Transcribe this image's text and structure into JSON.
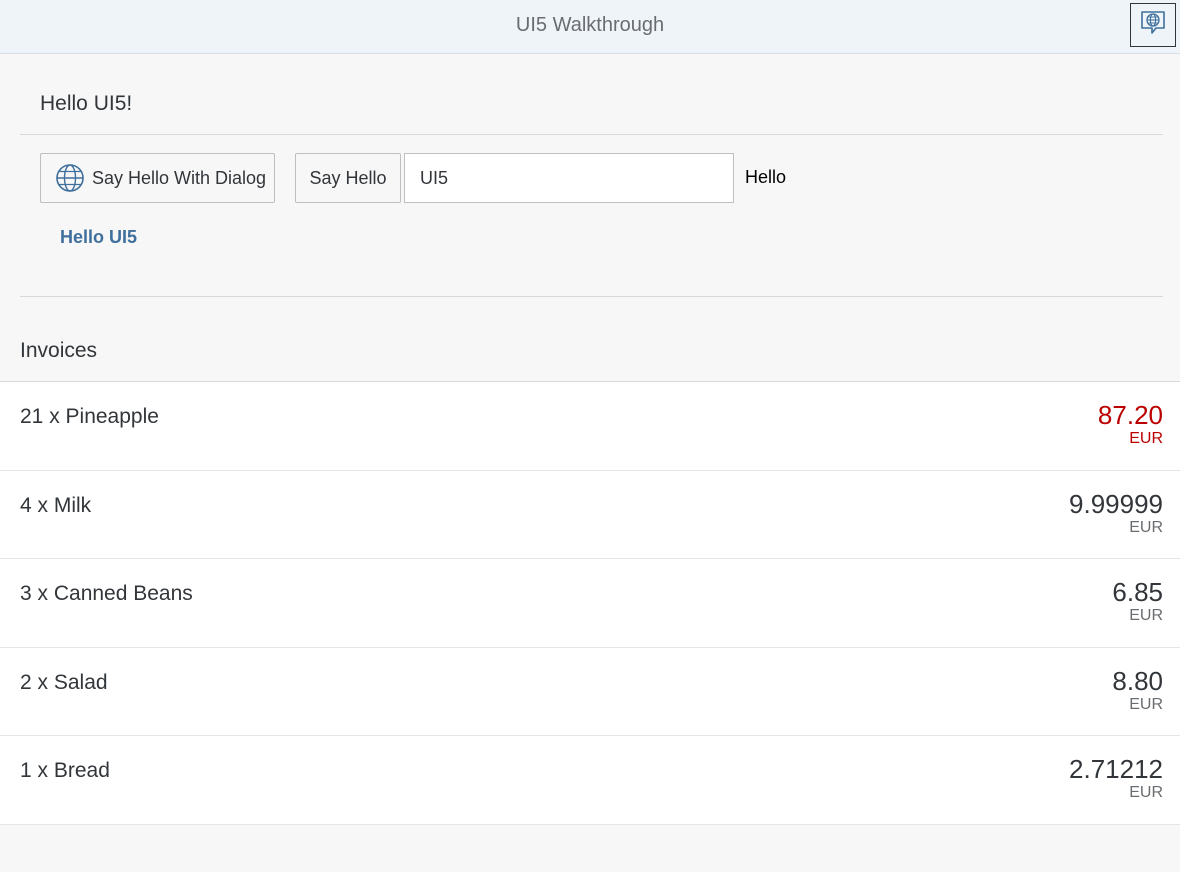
{
  "shell": {
    "title": "UI5 Walkthrough",
    "feedback_icon": "feedback-globe-icon"
  },
  "panel": {
    "title": "Hello UI5!",
    "dialog_button_label": "Say Hello With Dialog",
    "dialog_button_icon": "world-icon",
    "hello_button_label": "Say Hello",
    "name_input_value": "UI5",
    "greeting_text": "Hello",
    "link_text": "Hello UI5"
  },
  "invoices": {
    "title": "Invoices",
    "items": [
      {
        "title": "21 x Pineapple",
        "amount": "87.20",
        "currency": "EUR",
        "state": "error"
      },
      {
        "title": "4 x Milk",
        "amount": "9.99999",
        "currency": "EUR",
        "state": "none"
      },
      {
        "title": "3 x Canned Beans",
        "amount": "6.85",
        "currency": "EUR",
        "state": "none"
      },
      {
        "title": "2 x Salad",
        "amount": "8.80",
        "currency": "EUR",
        "state": "none"
      },
      {
        "title": "1 x Bread",
        "amount": "2.71212",
        "currency": "EUR",
        "state": "none"
      }
    ]
  },
  "colors": {
    "shell_background": "#eff4f9",
    "page_background": "#f7f7f7",
    "link": "#3f6f9c",
    "error": "#bb0000"
  }
}
